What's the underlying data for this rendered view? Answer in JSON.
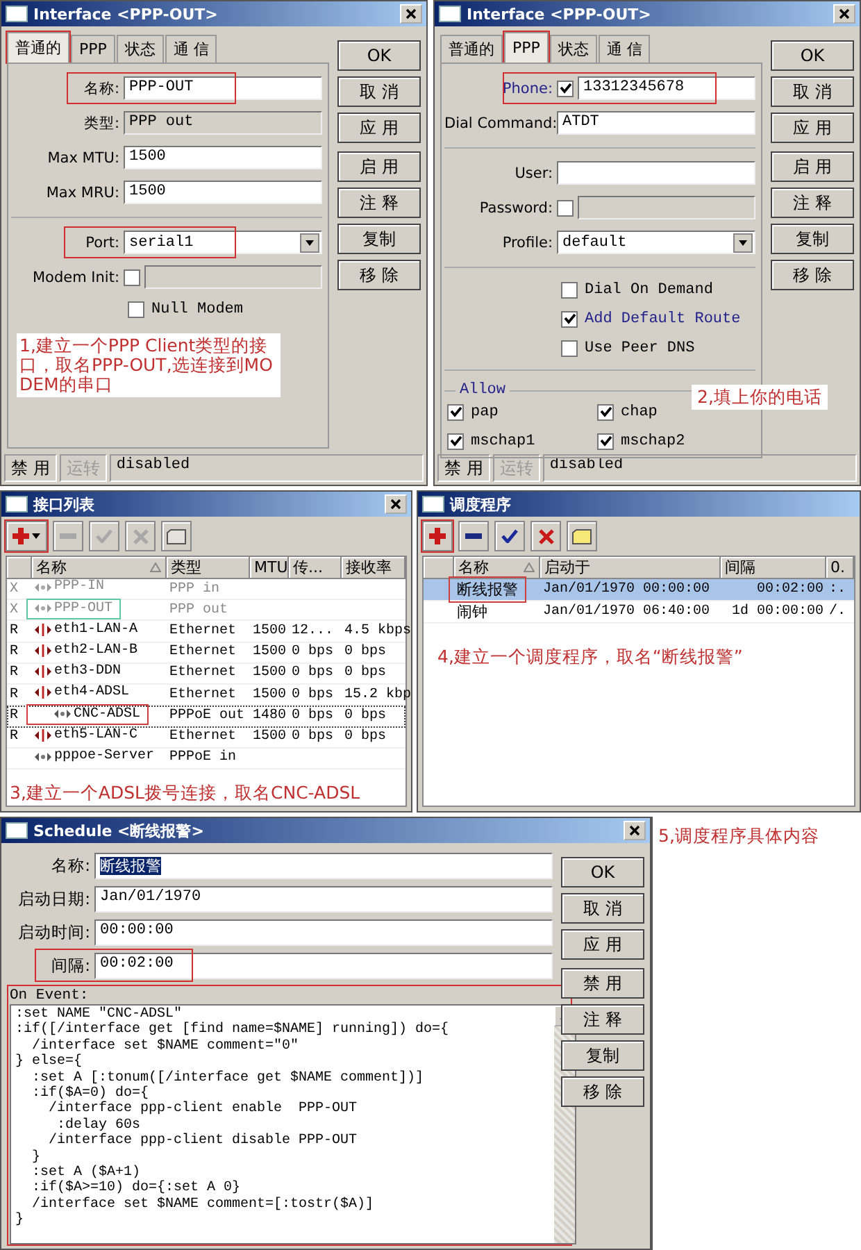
{
  "interface_dialogs": [
    {
      "title": "Interface <PPP-OUT>",
      "tabs": [
        {
          "label": "普通的",
          "selected": true,
          "highlighted": true
        },
        {
          "label": "PPP",
          "selected": false,
          "highlighted": false
        },
        {
          "label": "状态",
          "selected": false,
          "highlighted": false
        },
        {
          "label": "通 信",
          "selected": false,
          "highlighted": false
        }
      ],
      "fields": [
        {
          "kind": "text",
          "label": "名称:",
          "value": "PPP-OUT",
          "highlighted": true
        },
        {
          "kind": "readonly",
          "label": "类型:",
          "value": "PPP out",
          "highlighted": false
        },
        {
          "kind": "text",
          "label": "Max MTU:",
          "value": "1500",
          "highlighted": false
        },
        {
          "kind": "text",
          "label": "Max MRU:",
          "value": "1500",
          "highlighted": false
        },
        {
          "kind": "separator"
        },
        {
          "kind": "select",
          "label": "Port:",
          "value": "serial1",
          "highlighted": true
        },
        {
          "kind": "check-text",
          "label": "Modem Init:",
          "checked": false,
          "highlighted": false
        },
        {
          "kind": "checkbox",
          "label": "Null Modem",
          "checked": false,
          "modified": false
        }
      ],
      "note": "1,建立一个PPP Client类型的接口，取名PPP-OUT,选连接到MODEM的串口",
      "buttons": [
        [
          "OK",
          "取 消",
          "应 用"
        ],
        [
          "启 用",
          "注 释",
          "复制",
          "移 除"
        ]
      ],
      "status": [
        {
          "label": "禁 用",
          "disabled": false
        },
        {
          "label": "运转",
          "disabled": true
        },
        {
          "label": "disabled",
          "disabled": false
        }
      ]
    },
    {
      "title": "Interface <PPP-OUT>",
      "tabs": [
        {
          "label": "普通的",
          "selected": false,
          "highlighted": false
        },
        {
          "label": "PPP",
          "selected": true,
          "highlighted": true
        },
        {
          "label": "状态",
          "selected": false,
          "highlighted": false
        },
        {
          "label": "通 信",
          "selected": false,
          "highlighted": false
        }
      ],
      "fields": [
        {
          "kind": "check-text",
          "label": "Phone:",
          "value": "13312345678",
          "checked": true,
          "modified": true,
          "highlighted": true
        },
        {
          "kind": "text",
          "label": "Dial Command:",
          "value": "ATDT",
          "modified": false,
          "highlighted": false
        },
        {
          "kind": "separator"
        },
        {
          "kind": "text",
          "label": "User:",
          "modified": false,
          "highlighted": false
        },
        {
          "kind": "check-text",
          "label": "Password:",
          "checked": false,
          "modified": false,
          "highlighted": false
        },
        {
          "kind": "select",
          "label": "Profile:",
          "value": "default",
          "modified": false,
          "highlighted": false
        },
        {
          "kind": "separator"
        },
        {
          "kind": "checkbox",
          "label": "Dial On Demand",
          "checked": false,
          "modified": false
        },
        {
          "kind": "checkbox",
          "label": "Add Default Route",
          "checked": true,
          "modified": true
        },
        {
          "kind": "checkbox",
          "label": "Use Peer DNS",
          "checked": false,
          "modified": false
        },
        {
          "kind": "separator"
        }
      ],
      "allow": {
        "title": "Allow",
        "options": [
          {
            "label": "pap",
            "checked": true
          },
          {
            "label": "chap",
            "checked": true
          },
          {
            "label": "mschap1",
            "checked": true
          },
          {
            "label": "mschap2",
            "checked": true
          }
        ]
      },
      "note": "2,填上你的电话",
      "buttons": [
        [
          "OK",
          "取 消",
          "应 用"
        ],
        [
          "启 用",
          "注 释",
          "复制",
          "移 除"
        ]
      ],
      "status": [
        {
          "label": "禁 用",
          "disabled": false
        },
        {
          "label": "运转",
          "disabled": true
        },
        {
          "label": "disabled",
          "disabled": false
        }
      ]
    }
  ],
  "interface_list": {
    "title": "接口列表",
    "toolbar": [
      {
        "kind": "add",
        "disabled": false,
        "highlighted": true
      },
      {
        "kind": "remove",
        "disabled": true,
        "highlighted": false
      },
      {
        "kind": "enable",
        "disabled": true,
        "highlighted": false
      },
      {
        "kind": "disable",
        "disabled": true,
        "highlighted": false
      },
      {
        "kind": "comment",
        "disabled": true,
        "highlighted": false
      }
    ],
    "columns": [
      {
        "label": "名称",
        "sorted": true
      },
      {
        "label": "类型"
      },
      {
        "label": "MTU"
      },
      {
        "label": "传..."
      },
      {
        "label": "接收率"
      }
    ],
    "rows": [
      {
        "flag": "X",
        "kind": "ppp",
        "name": "PPP-IN",
        "type": "PPP in",
        "disabled": true,
        "focused": false
      },
      {
        "flag": "X",
        "kind": "ppp",
        "name": "PPP-OUT",
        "type": "PPP out",
        "disabled": true,
        "focused": false,
        "color": "#5fc9a0"
      },
      {
        "flag": "R",
        "kind": "ethernet",
        "name": "eth1-LAN-A",
        "type": "Ethernet",
        "mtu": "1500",
        "tx": "12...",
        "rx": "4.5 kbps",
        "disabled": false,
        "focused": false
      },
      {
        "flag": "R",
        "kind": "ethernet",
        "name": "eth2-LAN-B",
        "type": "Ethernet",
        "mtu": "1500",
        "tx": "0 bps",
        "rx": "0 bps",
        "disabled": false,
        "focused": false
      },
      {
        "flag": "R",
        "kind": "ethernet",
        "name": "eth3-DDN",
        "type": "Ethernet",
        "mtu": "1500",
        "tx": "0 bps",
        "rx": "0 bps",
        "disabled": false,
        "focused": false
      },
      {
        "flag": "R",
        "kind": "ethernet",
        "name": "eth4-ADSL",
        "type": "Ethernet",
        "mtu": "1500",
        "tx": "0 bps",
        "rx": "15.2 kbp",
        "disabled": false,
        "focused": false,
        "children": [
          {
            "flag": "R",
            "kind": "ppp",
            "name": "CNC-ADSL",
            "type": "PPPoE out",
            "mtu": "1480",
            "tx": "0 bps",
            "rx": "0 bps",
            "disabled": false,
            "focused": true,
            "color": "#d04040"
          }
        ]
      },
      {
        "flag": "R",
        "kind": "ethernet",
        "name": "eth5-LAN-C",
        "type": "Ethernet",
        "mtu": "1500",
        "tx": "0 bps",
        "rx": "0 bps",
        "disabled": false,
        "focused": false
      },
      {
        "kind": "ppp",
        "name": "pppoe-Server",
        "type": "PPPoE in",
        "disabled": false,
        "focused": false
      }
    ],
    "note": "3,建立一个ADSL拨号连接，取名CNC-ADSL"
  },
  "scheduler": {
    "title": "调度程序",
    "toolbar": [
      {
        "kind": "add",
        "disabled": false,
        "highlighted": true
      },
      {
        "kind": "remove",
        "disabled": false,
        "highlighted": false
      },
      {
        "kind": "enable",
        "disabled": false,
        "highlighted": false
      },
      {
        "kind": "disable",
        "disabled": false,
        "highlighted": false
      },
      {
        "kind": "comment",
        "disabled": false,
        "highlighted": false
      }
    ],
    "columns": [
      {
        "label": "名称",
        "sorted": true
      },
      {
        "label": "启动于"
      },
      {
        "label": "间隔"
      },
      {
        "label": "0."
      }
    ],
    "rows": [
      {
        "name": "断线报警",
        "start": "Jan/01/1970 00:00:00",
        "interval": "00:02:00",
        "column_4": ":.",
        "selected": true,
        "color": "#d04040"
      },
      {
        "name": "闹钟",
        "start": "Jan/01/1970 06:40:00",
        "interval": "1d 00:00:00",
        "column_4": "/.",
        "selected": false
      }
    ],
    "note": "4,建立一个调度程序，取名“断线报警”"
  },
  "schedule_dialog": {
    "title": "Schedule <断线报警>",
    "fields": [
      {
        "label": "名称:",
        "value": "断线报警",
        "text_selected": true,
        "highlighted": false
      },
      {
        "label": "启动日期:",
        "value": "Jan/01/1970",
        "text_selected": false,
        "highlighted": false
      },
      {
        "label": "启动时间:",
        "value": "00:00:00",
        "text_selected": false,
        "highlighted": false
      },
      {
        "label": "间隔:",
        "value": "00:02:00",
        "text_selected": false,
        "highlighted": true
      }
    ],
    "on_event": {
      "label": "On Event:",
      "highlighted": true,
      "lines": [
        ":set NAME \"CNC-ADSL\"",
        ":if([/interface get [find name=$NAME] running]) do={",
        "  /interface set $NAME comment=\"0\"",
        "} else={",
        "  :set A [:tonum([/interface get $NAME comment])]",
        "  :if($A=0) do={",
        "    /interface ppp-client enable  PPP-OUT",
        "     :delay 60s",
        "    /interface ppp-client disable PPP-OUT",
        "  }",
        "  :set A ($A+1)",
        "  :if($A>=10) do={:set A 0}",
        "  /interface set $NAME comment=[:tostr($A)]",
        "}"
      ]
    },
    "buttons": [
      [
        "OK",
        "取 消",
        "应 用"
      ],
      [
        "禁 用",
        "注 释",
        "复制",
        "移 除"
      ]
    ],
    "note": "5,调度程序具体内容"
  }
}
